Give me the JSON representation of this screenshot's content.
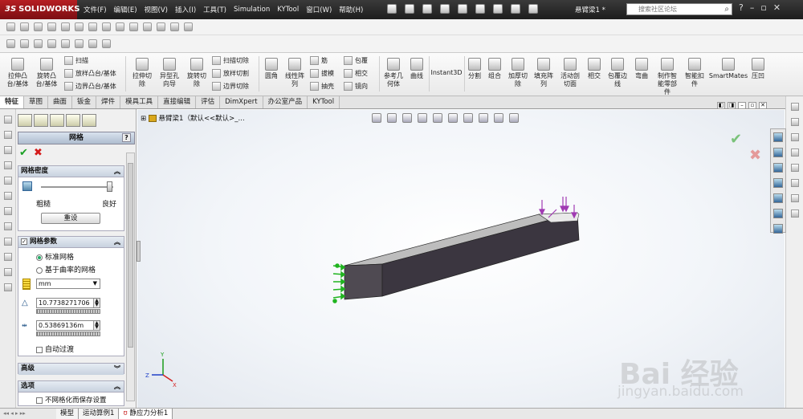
{
  "app": {
    "logo": "SOLIDWORKS",
    "logo_prefix": "3S",
    "document_name": "悬臂梁1 *",
    "menu": [
      "文件(F)",
      "编辑(E)",
      "视图(V)",
      "插入(I)",
      "工具(T)",
      "Simulation",
      "KYTool",
      "窗口(W)",
      "帮助(H)"
    ],
    "search": {
      "placeholder": "搜索社区论坛"
    }
  },
  "ribbon": {
    "big": [
      {
        "label": "拉伸凸\n台/基体"
      },
      {
        "label": "旋转凸\n台/基体"
      },
      {
        "label": "拉伸切\n除"
      },
      {
        "label": "异型孔\n向导"
      },
      {
        "label": "旋转切\n除"
      },
      {
        "label": "圆角"
      },
      {
        "label": "线性阵\n列"
      },
      {
        "label": "参考几\n何体"
      },
      {
        "label": "曲线"
      },
      {
        "label": "Instant3D"
      },
      {
        "label": "分割"
      },
      {
        "label": "组合"
      },
      {
        "label": "加厚切\n除"
      },
      {
        "label": "填充阵\n列"
      },
      {
        "label": "活动剖\n切面"
      },
      {
        "label": "相交"
      },
      {
        "label": "包覆边\n线"
      },
      {
        "label": "弯曲"
      },
      {
        "label": "制作智\n能零部\n件"
      },
      {
        "label": "智能扣\n件"
      },
      {
        "label": "SmartMates"
      },
      {
        "label": "压凹"
      }
    ],
    "small": [
      "扫描",
      "放样凸台/基体",
      "边界凸台/基体",
      "扫描切除",
      "放样切割",
      "边界切除",
      "筋",
      "拔模",
      "抽壳",
      "包覆",
      "相交",
      "镜向"
    ]
  },
  "tabs": [
    "特征",
    "草图",
    "曲面",
    "钣金",
    "焊件",
    "模具工具",
    "直接编辑",
    "评估",
    "DimXpert",
    "办公室产品",
    "KYTool"
  ],
  "property_manager": {
    "title": "网格",
    "help": "?",
    "density": {
      "header": "网格密度",
      "coarse": "粗糙",
      "fine": "良好",
      "slider_level": 0.95,
      "reset_button": "重设"
    },
    "params": {
      "header": "网格参数",
      "option_standard": "标准网格",
      "option_curvature": "基于曲率的网格",
      "unit": "mm",
      "global_size": "10.7738271706",
      "tolerance": "0.53869136m",
      "auto_transition": "自动过渡"
    },
    "advanced": {
      "header": "高级"
    },
    "options": {
      "header": "选项",
      "no_mesh_save": "不网格化而保存设置"
    }
  },
  "viewport": {
    "tree_root": "悬臂梁1（默认<<默认>_..."
  },
  "bottom_tabs": [
    "模型",
    "运动算例1",
    "静应力分析1"
  ],
  "watermark": {
    "brand": "Bai 经验",
    "url": "jingyan.baidu.com"
  },
  "colors": {
    "accent_red": "#b61e22",
    "ok_green": "#1aa024",
    "cancel_red": "#d41a1a"
  }
}
